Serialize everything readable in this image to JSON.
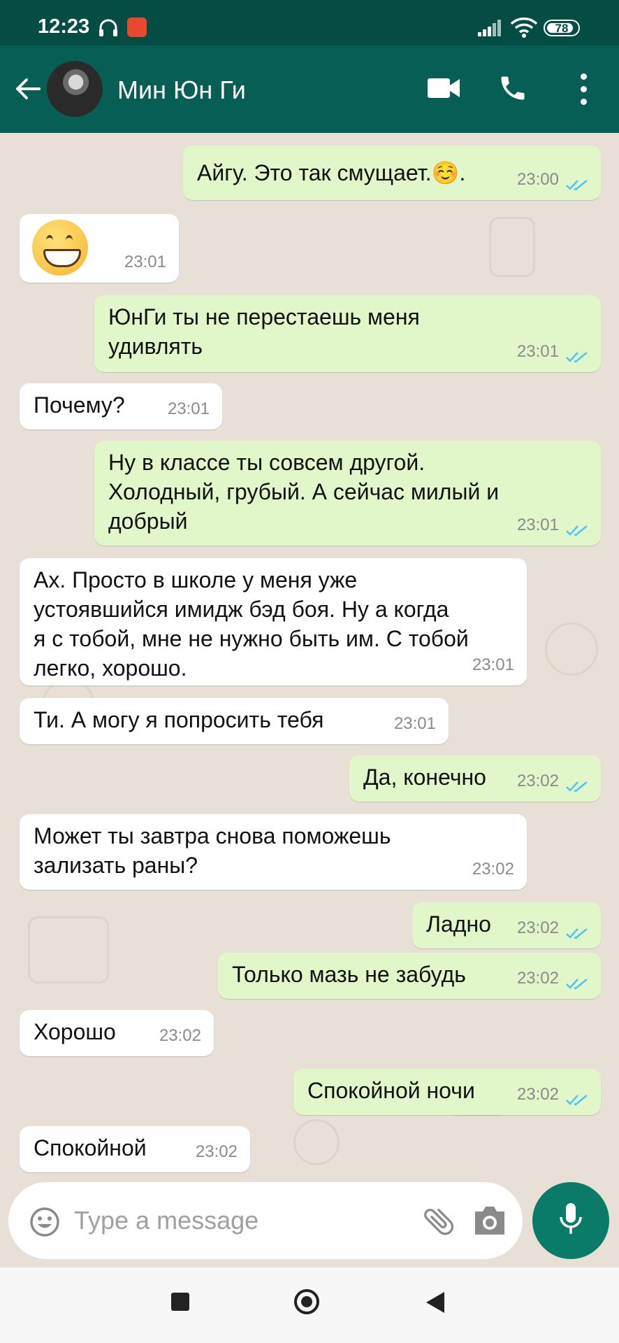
{
  "status_bar": {
    "time": "12:23",
    "battery": "78",
    "icons": [
      "headphones-icon",
      "app-notification-icon",
      "signal-icon",
      "wifi-icon",
      "battery-icon"
    ]
  },
  "header": {
    "contact_name": "Мин Юн Ги",
    "icons": [
      "back-arrow-icon",
      "video-call-icon",
      "phone-icon",
      "more-vert-icon"
    ]
  },
  "messages": [
    {
      "dir": "out",
      "text": "Айгу. Это так смущает.☺️.",
      "time": "23:00",
      "read": true
    },
    {
      "dir": "in",
      "text": "😁",
      "time": "23:01"
    },
    {
      "dir": "out",
      "lines": [
        "ЮнГи ты не перестаешь меня",
        "удивлять"
      ],
      "time": "23:01",
      "read": true
    },
    {
      "dir": "in",
      "text": "Почему?",
      "time": "23:01"
    },
    {
      "dir": "out",
      "lines": [
        "Ну в классе ты совсем другой.",
        "Холодный, грубый. А сейчас милый и",
        "добрый"
      ],
      "time": "23:01",
      "read": true
    },
    {
      "dir": "in",
      "lines": [
        "Ах. Просто в школе у меня уже",
        "устоявшийся имидж бэд боя. Ну а когда",
        "я с тобой, мне не нужно быть им. С тобой",
        "легко, хорошо."
      ],
      "time": "23:01"
    },
    {
      "dir": "in",
      "text": "Ти. А могу я попросить тебя",
      "time": "23:01"
    },
    {
      "dir": "out",
      "text": "Да, конечно",
      "time": "23:02",
      "read": true
    },
    {
      "dir": "in",
      "lines": [
        "Может ты завтра снова поможешь",
        "зализать раны?"
      ],
      "time": "23:02"
    },
    {
      "dir": "out",
      "text": "Ладно",
      "time": "23:02",
      "read": true
    },
    {
      "dir": "out",
      "text": "Только мазь не забудь",
      "time": "23:02",
      "read": true
    },
    {
      "dir": "in",
      "text": "Хорошо",
      "time": "23:02"
    },
    {
      "dir": "out",
      "text": "Спокойной ночи",
      "time": "23:02",
      "read": true
    },
    {
      "dir": "in",
      "text": "Спокойной",
      "time": "23:02"
    }
  ],
  "input": {
    "placeholder": "Type a message",
    "value": ""
  },
  "colors": {
    "header": "#075e54",
    "status_bar": "#054d44",
    "outgoing_bubble": "#e1f6c9",
    "incoming_bubble": "#ffffff",
    "chat_background": "#e8e0d6",
    "read_ticks": "#4fc3f7",
    "mic_button": "#0a7a69"
  }
}
